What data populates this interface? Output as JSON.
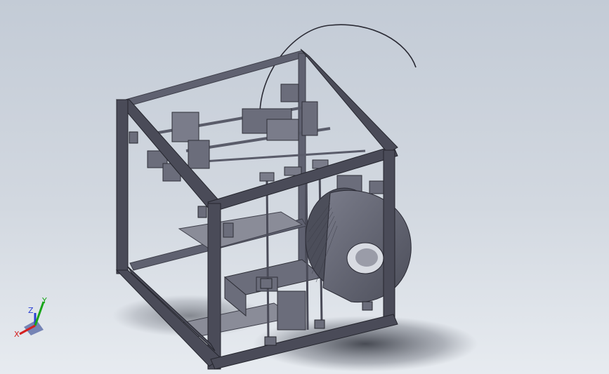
{
  "scene": {
    "model": "3d-printer-assembly",
    "background_top": "#c3cbd6",
    "background_bottom": "#e7ebf0",
    "frame_color": "#3e3f4a",
    "part_color": "#6f7180",
    "spool_color": "#5a5c6a"
  },
  "triad": {
    "x_label": "X",
    "y_label": "Y",
    "z_label": "Z",
    "x_color": "#d42020",
    "y_color": "#1aa61a",
    "z_color": "#2a3fd4"
  }
}
